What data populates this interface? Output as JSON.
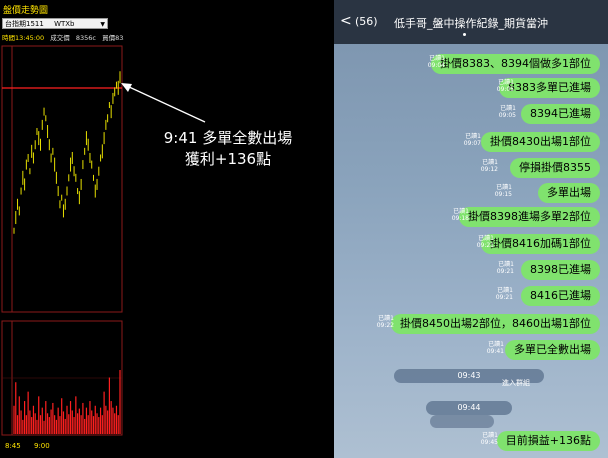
{
  "left_panel": {
    "title": "盤價走勢圖",
    "symbol": "台指期1511",
    "symbol_sub": "WTXb",
    "quote_time": "時間13:45:00",
    "quote_volume": "成交價",
    "quote_price": "8356c",
    "quote_buy": "買價8356",
    "quote_state": "漲價",
    "time_ticks": [
      "8:45",
      "9:00"
    ],
    "price_series": [
      120,
      130,
      140,
      135,
      150,
      160,
      155,
      170,
      175,
      165,
      180,
      175,
      185,
      195,
      190,
      185,
      200,
      210,
      205,
      195,
      185,
      175,
      180,
      170,
      160,
      150,
      140,
      145,
      135,
      140,
      150,
      160,
      170,
      175,
      165,
      160,
      150,
      145,
      155,
      170,
      180,
      190,
      185,
      175,
      170,
      160,
      150,
      155,
      165,
      175,
      180,
      190,
      200,
      205,
      215,
      210,
      220,
      225,
      230,
      228,
      236
    ],
    "volume_series": [
      30,
      55,
      20,
      40,
      25,
      15,
      35,
      20,
      45,
      25,
      18,
      30,
      22,
      15,
      40,
      20,
      28,
      14,
      35,
      22,
      18,
      26,
      33,
      20,
      15,
      28,
      19,
      38,
      24,
      16,
      30,
      21,
      35,
      25,
      18,
      40,
      22,
      27,
      20,
      33,
      16,
      28,
      20,
      35,
      25,
      19,
      30,
      22,
      18,
      28,
      20,
      45,
      30,
      25,
      60,
      35,
      28,
      22,
      30,
      20,
      68
    ],
    "colors": {
      "price": "#e8e000",
      "volume": "#ff2020",
      "grid": "#8b1a1a",
      "level": "#ff2020"
    }
  },
  "annotation": {
    "line1": "9:41 多單全數出場",
    "line2": "獲利+136點"
  },
  "chat": {
    "back_icon": "<",
    "count": "(56)",
    "title": "低手哥_盤中操作紀錄_期貨當沖",
    "messages": [
      {
        "text": "掛價8383、8394個做多1部位",
        "read": "已讀1",
        "time": "09:04"
      },
      {
        "text": "8383多單已進場",
        "read": "已讀1",
        "time": "09:05"
      },
      {
        "text": "8394已進場",
        "read": "已讀1",
        "time": "09:05"
      },
      {
        "text": "掛價8430出場1部位",
        "read": "已讀1",
        "time": "09:07"
      },
      {
        "text": "停損掛價8355",
        "read": "已讀1",
        "time": "09:12"
      },
      {
        "text": "多單出場",
        "read": "已讀1",
        "time": "09:15"
      },
      {
        "text": "掛價8398進場多單2部位",
        "read": "已讀1",
        "time": "09:18"
      },
      {
        "text": "掛價8416加碼1部位",
        "read": "已讀1",
        "time": "09:21"
      },
      {
        "text": "8398已進場",
        "read": "已讀1",
        "time": "09:21"
      },
      {
        "text": "8416已進場",
        "read": "已讀1",
        "time": "09:21"
      },
      {
        "text": "掛價8450出場2部位，8460出場1部位",
        "read": "已讀1",
        "time": "09:22"
      },
      {
        "text": "多單已全數出場",
        "read": "已讀1",
        "time": "09:41"
      }
    ],
    "system_time_1": "09:43",
    "join_text": "進入群組",
    "system_time_2": "09:44",
    "final_message": {
      "text": "目前損益+136點",
      "read": "已讀1",
      "time": "09:45"
    }
  }
}
